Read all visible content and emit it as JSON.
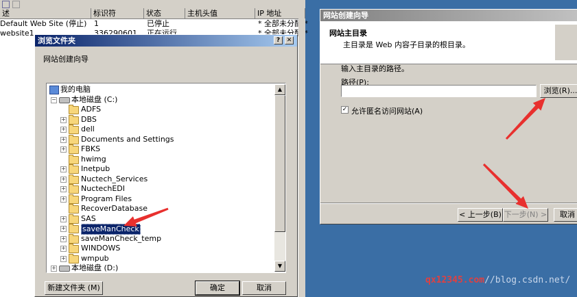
{
  "background_list": {
    "columns": [
      "述",
      "标识符",
      "状态",
      "主机头值",
      "IP 地址"
    ],
    "rows": [
      [
        "Default Web Site (停止)",
        "1",
        "已停止",
        "",
        "* 全部未分配 *"
      ],
      [
        "website1",
        "336290601",
        "正在运行",
        "",
        "* 全部未分配 *"
      ]
    ]
  },
  "browse_dialog": {
    "title": "浏览文件夹",
    "help_button": "?",
    "close_button": "✕",
    "description": "网站创建向导",
    "tree": {
      "root": "我的电脑",
      "drive_c": "本地磁盘 (C:)",
      "folders": [
        "ADFS",
        "DBS",
        "dell",
        "Documents and Settings",
        "FBKS",
        "hwimg",
        "Inetpub",
        "Nuctech_Services",
        "NuctechEDI",
        "Program Files",
        "RecoverDatabase",
        "SAS",
        "saveManCheck",
        "saveManCheck_temp",
        "WINDOWS",
        "wmpub"
      ],
      "expandable": [
        false,
        true,
        true,
        true,
        true,
        false,
        true,
        true,
        true,
        true,
        false,
        true,
        true,
        true,
        true,
        true
      ],
      "selected": "saveManCheck",
      "drive_d": "本地磁盘 (D:)"
    },
    "new_folder_button": "新建文件夹 (M)",
    "ok_button": "确定",
    "cancel_button": "取消"
  },
  "wizard": {
    "title": "网站创建向导",
    "header_title": "网站主目录",
    "header_subtitle": "主目录是 Web 内容子目录的根目录。",
    "path_prompt": "输入主目录的路径。",
    "path_label": "路径(P):",
    "path_value": "",
    "browse_button": "浏览(R)...",
    "anonymous_label": "允许匿名访问网站(A)",
    "anonymous_checked": true,
    "back_button": "< 上一步(B)",
    "next_button": "下一步(N) >",
    "cancel_button": "取消"
  },
  "watermark": {
    "red_part": "qx12345.com",
    "url_part": "//blog.csdn.net/"
  },
  "colors": {
    "desktop": "#3a6ea5",
    "title_active": "#0a246a",
    "arrow": "#e8302e"
  }
}
